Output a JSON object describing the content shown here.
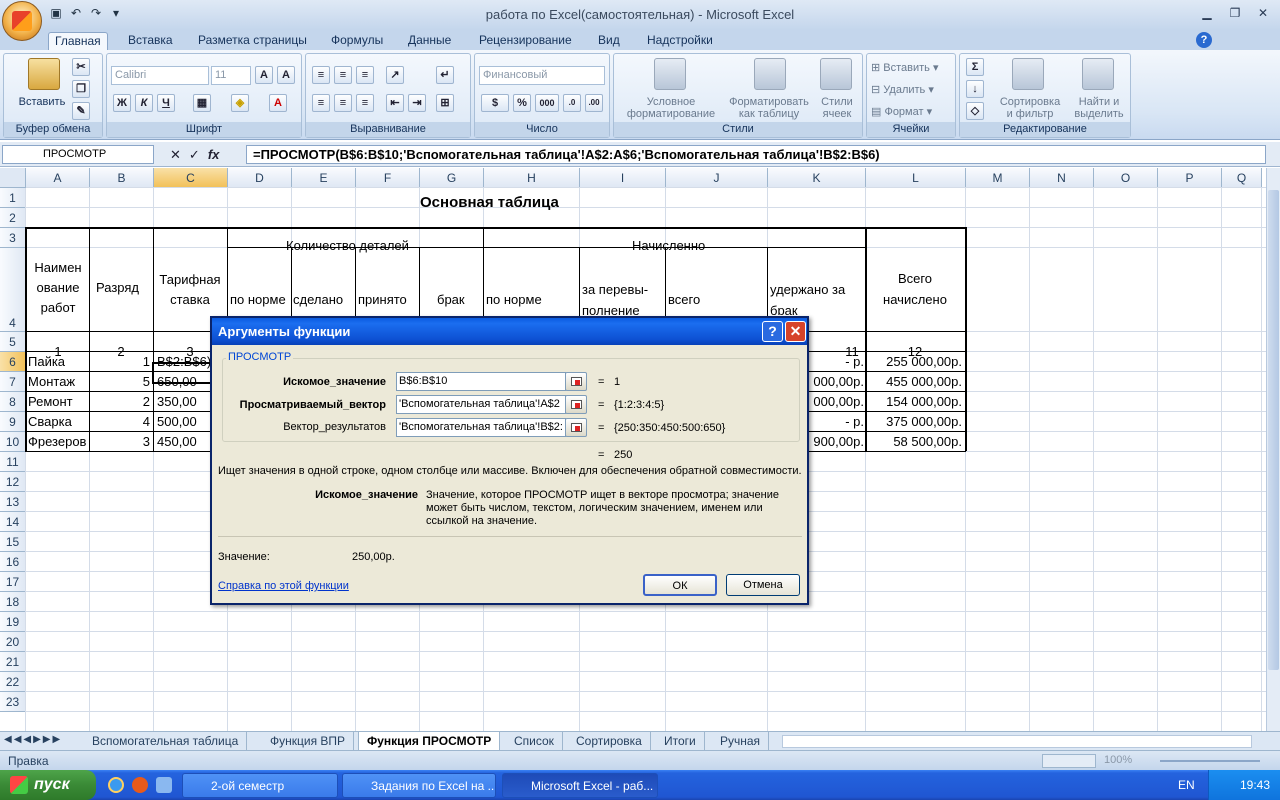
{
  "window": {
    "title": "работа по Excel(самостоятельная) - Microsoft Excel"
  },
  "ribbon": {
    "tabs": [
      "Главная",
      "Вставка",
      "Разметка страницы",
      "Формулы",
      "Данные",
      "Рецензирование",
      "Вид",
      "Надстройки"
    ],
    "clipboard": {
      "paste": "Вставить",
      "label": "Буфер обмена"
    },
    "font": {
      "name": "Calibri",
      "size": "11",
      "label": "Шрифт"
    },
    "alignment": {
      "label": "Выравнивание"
    },
    "number": {
      "format": "Финансовый",
      "label": "Число"
    },
    "styles": {
      "conditional": "Условное форматирование",
      "table": "Форматировать как таблицу",
      "cell": "Стили ячеек",
      "label": "Стили"
    },
    "cells": {
      "insert": "Вставить",
      "delete": "Удалить",
      "format": "Формат",
      "label": "Ячейки"
    },
    "editing": {
      "sort": "Сортировка и фильтр",
      "find": "Найти и выделить",
      "label": "Редактирование"
    }
  },
  "formula_bar": {
    "name_box": "ПРОСМОТР",
    "formula": "=ПРОСМОТР(B$6:B$10;'Вспомогательная таблица'!A$2:A$6;'Вспомогательная таблица'!B$2:B$6)"
  },
  "columns": [
    "A",
    "B",
    "C",
    "D",
    "E",
    "F",
    "G",
    "H",
    "I",
    "J",
    "K",
    "L",
    "M",
    "N",
    "O",
    "P",
    "Q"
  ],
  "rows": [
    "1",
    "2",
    "3",
    "4",
    "5",
    "6",
    "7",
    "8",
    "9",
    "10",
    "11",
    "12",
    "13",
    "14",
    "15",
    "16",
    "17",
    "18",
    "19",
    "20",
    "21",
    "22",
    "23"
  ],
  "sheet": {
    "title": "Основная таблица",
    "h_qty": "Количество деталей",
    "h_acc": "Начисленно",
    "h_name": "Наимен ование работ",
    "h_rank": "Разряд",
    "h_rate": "Тарифная ставка",
    "h_norm": "по норме",
    "h_done": "сделано",
    "h_accepted": "принято",
    "h_defect": "брак",
    "h_norm2": "по норме",
    "h_over": "за перевы- полнение",
    "h_total": "всего",
    "h_withheld": "удержано за брак",
    "h_grand": "Всего начислено",
    "nums": {
      "a": "1",
      "b": "2",
      "c": "3",
      "k": "11",
      "l": "12"
    },
    "data_rows": [
      {
        "name": "Пайка",
        "rank": "1",
        "rate": "B$2:B$6)",
        "k": "-   р.",
        "l": "255 000,00р."
      },
      {
        "name": "Монтаж",
        "rank": "5",
        "rate": "650,00",
        "k": "000,00р.",
        "l": "455 000,00р."
      },
      {
        "name": "Ремонт",
        "rank": "2",
        "rate": "350,00",
        "k": "000,00р.",
        "l": "154 000,00р."
      },
      {
        "name": "Сварка",
        "rank": "4",
        "rate": "500,00",
        "k": "-   р.",
        "l": "375 000,00р."
      },
      {
        "name": "Фрезеров",
        "rank": "3",
        "rate": "450,00",
        "k": "900,00р.",
        "l": "58 500,00р."
      }
    ]
  },
  "dialog": {
    "title": "Аргументы функции",
    "group": "ПРОСМОТР",
    "args": [
      {
        "label": "Искомое_значение",
        "value": "B$6:B$10",
        "result": "1"
      },
      {
        "label": "Просматриваемый_вектор",
        "value": "'Вспомогательная таблица'!A$2",
        "result": "{1:2:3:4:5}"
      },
      {
        "label": "Вектор_результатов",
        "value": "'Вспомогательная таблица'!B$2:",
        "result": "{250:350:450:500:650}"
      }
    ],
    "eq": "=",
    "total_result": "250",
    "description": "Ищет значения в одной строке, одном столбце или массиве. Включен для обеспечения обратной совместимости.",
    "arg_name": "Искомое_значение",
    "arg_desc": "Значение, которое ПРОСМОТР ищет в векторе просмотра; значение может быть числом, текстом, логическим значением, именем или ссылкой на значение.",
    "value_label": "Значение:",
    "value": "250,00р.",
    "help_link": "Справка по этой функции",
    "ok": "ОК",
    "cancel": "Отмена"
  },
  "sheet_tabs": [
    "Вспомогательная таблица",
    "Функция ВПР",
    "Функция ПРОСМОТР",
    "Список",
    "Сортировка",
    "Итоги",
    "Ручная"
  ],
  "status": {
    "mode": "Правка",
    "zoom": "100%"
  },
  "taskbar": {
    "start": "пуск",
    "tasks": [
      "2-ой семестр",
      "Задания по Excel на ...",
      "Microsoft Excel - раб..."
    ],
    "lang": "EN",
    "clock": "19:43"
  }
}
